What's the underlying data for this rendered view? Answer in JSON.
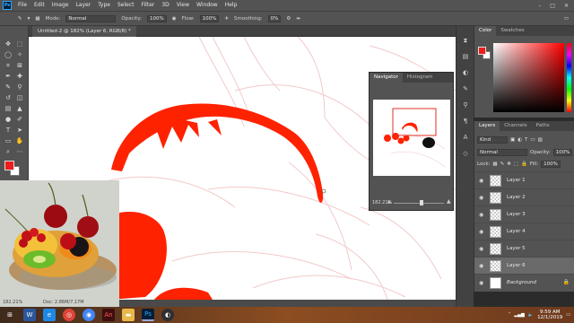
{
  "menubar": {
    "app_icon": "Ps",
    "items": [
      "File",
      "Edit",
      "Image",
      "Layer",
      "Type",
      "Select",
      "Filter",
      "3D",
      "View",
      "Window",
      "Help"
    ],
    "window_controls": [
      "–",
      "□",
      "✕"
    ]
  },
  "options": {
    "mode_label": "Mode:",
    "mode_value": "Normal",
    "opacity_label": "Opacity:",
    "opacity_value": "100%",
    "flow_label": "Flow:",
    "flow_value": "100%",
    "smoothing_label": "Smoothing:",
    "smoothing_value": "0%"
  },
  "document": {
    "tab_label": "Untitled-2 @ 182% (Layer 6, RGB/8) *",
    "status_zoom": "182.21%",
    "status_doc": "Doc: 2.86M/7.17M"
  },
  "colors": {
    "foreground": "#ee1c1c",
    "background": "#ffffff",
    "paint_red": "#ff2200"
  },
  "navigator": {
    "tabs": [
      "Navigator",
      "Histogram"
    ],
    "zoom": "182.21%"
  },
  "color_panel": {
    "tabs": [
      "Color",
      "Swatches"
    ]
  },
  "layers_panel": {
    "tabs": [
      "Layers",
      "Channels",
      "Paths"
    ],
    "kind_filter": "Kind",
    "blend_mode": "Normal",
    "opacity_label": "Opacity:",
    "opacity_value": "100%",
    "lock_label": "Lock:",
    "fill_label": "Fill:",
    "fill_value": "100%",
    "layers": [
      {
        "name": "Layer 1",
        "selected": false
      },
      {
        "name": "Layer 2",
        "selected": false
      },
      {
        "name": "Layer 3",
        "selected": false
      },
      {
        "name": "Layer 4",
        "selected": false
      },
      {
        "name": "Layer 5",
        "selected": false
      },
      {
        "name": "Layer 6",
        "selected": true
      },
      {
        "name": "Background",
        "selected": false
      }
    ]
  },
  "taskbar": {
    "apps": [
      "start-icon",
      "word-icon",
      "explorer-icon",
      "chrome-icon",
      "browser-icon",
      "animate-icon",
      "folder-icon",
      "photoshop-icon",
      "obs-icon"
    ],
    "time": "9:59 AM",
    "date": "12/1/2019"
  }
}
